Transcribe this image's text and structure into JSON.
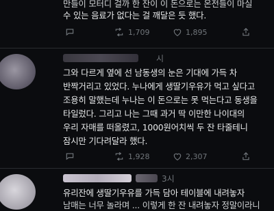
{
  "tweet1": {
    "lines": [
      "만들이 모터디 걸까 한 잔이 이 돈으로는 온전들이 마실",
      "수 있는 음료가 없다는 걸 깨달은 듯 했다."
    ],
    "stats": {
      "comments": "",
      "retweets": "1,709",
      "likes": "1,895",
      "share": ""
    }
  },
  "tweet2": {
    "handle_tail": "시",
    "lines": [
      "그와 다르게 옆에 선 남동생의 눈은 기대에 가득 차",
      "반짝거리고 있었다. 누나에게 생딸기우유가 먹고 싶다고",
      "조용히 말했는데 누나는 이 돈으로는 못 먹는다고 동생을",
      "타일렀다. 그리고 나는 그때 과거 딱 이만한 나이대의",
      "우리 자매를 떠올렸고, 1000원어치씩 두 잔 타줄테니",
      "잠시만 기다려달라 했다."
    ],
    "stats": {
      "comments": "",
      "retweets": "1,928",
      "likes": "2,307",
      "share": ""
    }
  },
  "tweet3": {
    "handle_tail": "3시",
    "lines": [
      "유리잔에 생딸기우유를 가득 담아 테이블에 내려놓자",
      "남매는 너무 놀라며 ... 이렇게 한 잔 내려놓자 정말이라니"
    ]
  },
  "colors": {
    "background": "#0b0c0f",
    "text": "#e7e9ea",
    "muted": "#71767b"
  },
  "icons": [
    "comment-icon",
    "retweet-icon",
    "heart-icon",
    "share-icon"
  ]
}
